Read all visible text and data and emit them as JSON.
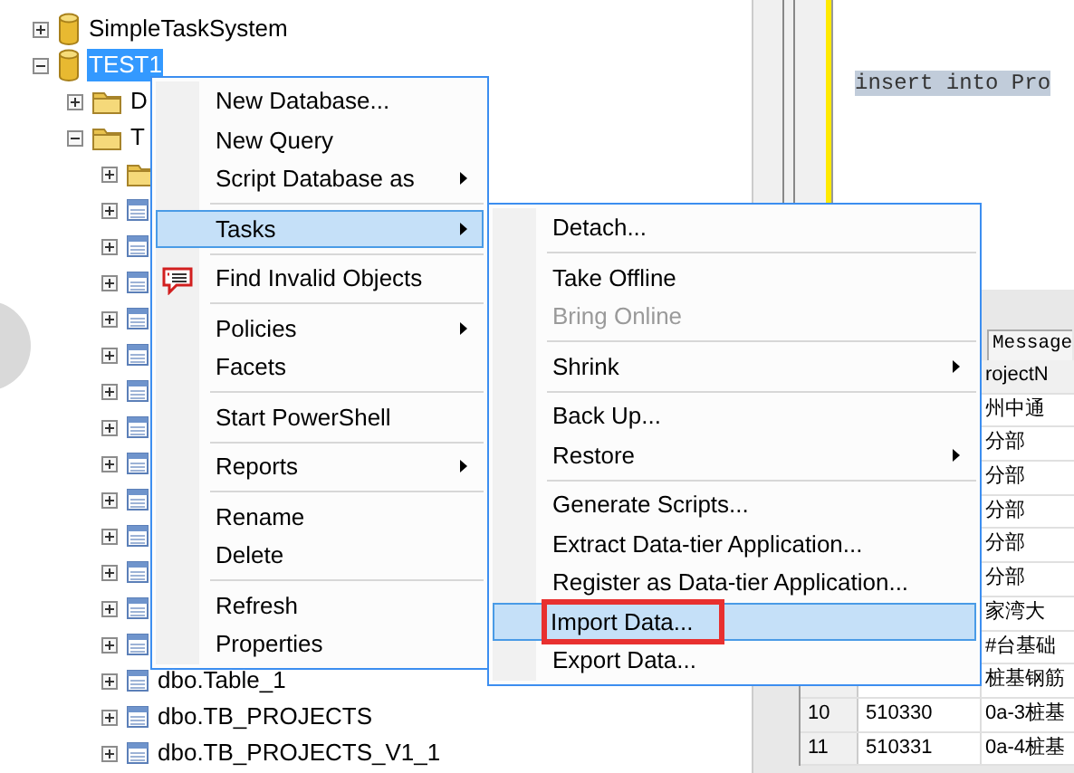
{
  "tree": {
    "items": [
      {
        "label": "SimpleTaskSystem",
        "kind": "database",
        "expanded": false,
        "selected": false
      },
      {
        "label": "TEST1",
        "kind": "database",
        "expanded": true,
        "selected": true,
        "children": [
          {
            "label": "D",
            "kind": "folder",
            "expanded": false,
            "selected": false
          },
          {
            "label": "T",
            "kind": "folder",
            "expanded": true,
            "selected": false,
            "children": [
              {
                "kind": "folder",
                "expanded": false,
                "selected": false
              },
              {
                "kind": "table",
                "expanded": false,
                "selected": false
              },
              {
                "kind": "table",
                "expanded": false,
                "selected": false
              },
              {
                "kind": "table",
                "expanded": false,
                "selected": false
              },
              {
                "kind": "table",
                "expanded": false,
                "selected": false
              },
              {
                "kind": "table",
                "expanded": false,
                "selected": false
              },
              {
                "kind": "table",
                "expanded": false,
                "selected": false
              },
              {
                "kind": "table",
                "expanded": false,
                "selected": false
              },
              {
                "kind": "table",
                "expanded": false,
                "selected": false
              },
              {
                "kind": "table",
                "expanded": false,
                "selected": false
              },
              {
                "kind": "table",
                "expanded": false,
                "selected": false
              },
              {
                "kind": "table",
                "expanded": false,
                "selected": false
              },
              {
                "kind": "table",
                "expanded": false,
                "selected": false
              },
              {
                "kind": "table",
                "expanded": false,
                "selected": false
              },
              {
                "label": "dbo.Table_1",
                "kind": "table",
                "expanded": false,
                "selected": false
              },
              {
                "label": "dbo.TB_PROJECTS",
                "kind": "table",
                "expanded": false,
                "selected": false
              },
              {
                "label": "dbo.TB_PROJECTS_V1_1",
                "kind": "table",
                "expanded": false,
                "selected": false
              }
            ]
          }
        ]
      }
    ]
  },
  "editor": {
    "code_line": "insert into Pro"
  },
  "results": {
    "tab": "Message",
    "column_header": "rojectN",
    "rows": [
      {
        "name": "州中通"
      },
      {
        "name": "分部"
      },
      {
        "name": "分部"
      },
      {
        "name": "分部"
      },
      {
        "name": "分部"
      },
      {
        "name": "分部"
      },
      {
        "name": "家湾大"
      },
      {
        "name": "#台基础"
      },
      {
        "name": "桩基钢筋"
      },
      {
        "row_number": "10",
        "id": "510330",
        "name": "0a-3桩基"
      },
      {
        "row_number": "11",
        "id": "510331",
        "name": "0a-4桩基"
      }
    ]
  },
  "context_menu": {
    "items": [
      {
        "kind": "item",
        "label": "New Database...",
        "submenu": false,
        "highlighted": false
      },
      {
        "kind": "item",
        "label": "New Query",
        "submenu": false,
        "highlighted": false
      },
      {
        "kind": "item",
        "label": "Script Database as",
        "submenu": true,
        "highlighted": false
      },
      {
        "kind": "separator"
      },
      {
        "kind": "item",
        "label": "Tasks",
        "submenu": true,
        "highlighted": true
      },
      {
        "kind": "separator"
      },
      {
        "kind": "item_with_icon",
        "label": "Find Invalid Objects",
        "submenu": false,
        "highlighted": false
      },
      {
        "kind": "separator"
      },
      {
        "kind": "item",
        "label": "Policies",
        "submenu": true,
        "highlighted": false
      },
      {
        "kind": "item",
        "label": "Facets",
        "submenu": false,
        "highlighted": false
      },
      {
        "kind": "separator"
      },
      {
        "kind": "item",
        "label": "Start PowerShell",
        "submenu": false,
        "highlighted": false
      },
      {
        "kind": "separator"
      },
      {
        "kind": "item",
        "label": "Reports",
        "submenu": true,
        "highlighted": false
      },
      {
        "kind": "separator"
      },
      {
        "kind": "item",
        "label": "Rename",
        "submenu": false,
        "highlighted": false
      },
      {
        "kind": "item",
        "label": "Delete",
        "submenu": false,
        "highlighted": false
      },
      {
        "kind": "separator"
      },
      {
        "kind": "item",
        "label": "Refresh",
        "submenu": false,
        "highlighted": false
      },
      {
        "kind": "item",
        "label": "Properties",
        "submenu": false,
        "highlighted": false
      }
    ]
  },
  "tasks_submenu": {
    "items": [
      {
        "kind": "item",
        "label": "Detach...",
        "submenu": false,
        "highlighted": false,
        "disabled": false,
        "marked": false
      },
      {
        "kind": "separator"
      },
      {
        "kind": "item",
        "label": "Take Offline",
        "submenu": false,
        "highlighted": false,
        "disabled": false,
        "marked": false
      },
      {
        "kind": "item",
        "label": "Bring Online",
        "submenu": false,
        "highlighted": false,
        "disabled": true,
        "marked": false
      },
      {
        "kind": "separator"
      },
      {
        "kind": "item",
        "label": "Shrink",
        "submenu": true,
        "highlighted": false,
        "disabled": false,
        "marked": false
      },
      {
        "kind": "separator"
      },
      {
        "kind": "item",
        "label": "Back Up...",
        "submenu": false,
        "highlighted": false,
        "disabled": false,
        "marked": false
      },
      {
        "kind": "item",
        "label": "Restore",
        "submenu": true,
        "highlighted": false,
        "disabled": false,
        "marked": false
      },
      {
        "kind": "separator"
      },
      {
        "kind": "item",
        "label": "Generate Scripts...",
        "submenu": false,
        "highlighted": false,
        "disabled": false,
        "marked": false
      },
      {
        "kind": "item",
        "label": "Extract Data-tier Application...",
        "submenu": false,
        "highlighted": false,
        "disabled": false,
        "marked": false
      },
      {
        "kind": "item",
        "label": "Register as Data-tier Application...",
        "submenu": false,
        "highlighted": false,
        "disabled": false,
        "marked": false
      },
      {
        "kind": "item",
        "label": "Import Data...",
        "submenu": false,
        "highlighted": true,
        "disabled": false,
        "marked": true
      },
      {
        "kind": "item",
        "label": "Export Data...",
        "submenu": false,
        "highlighted": false,
        "disabled": false,
        "marked": false
      }
    ]
  }
}
